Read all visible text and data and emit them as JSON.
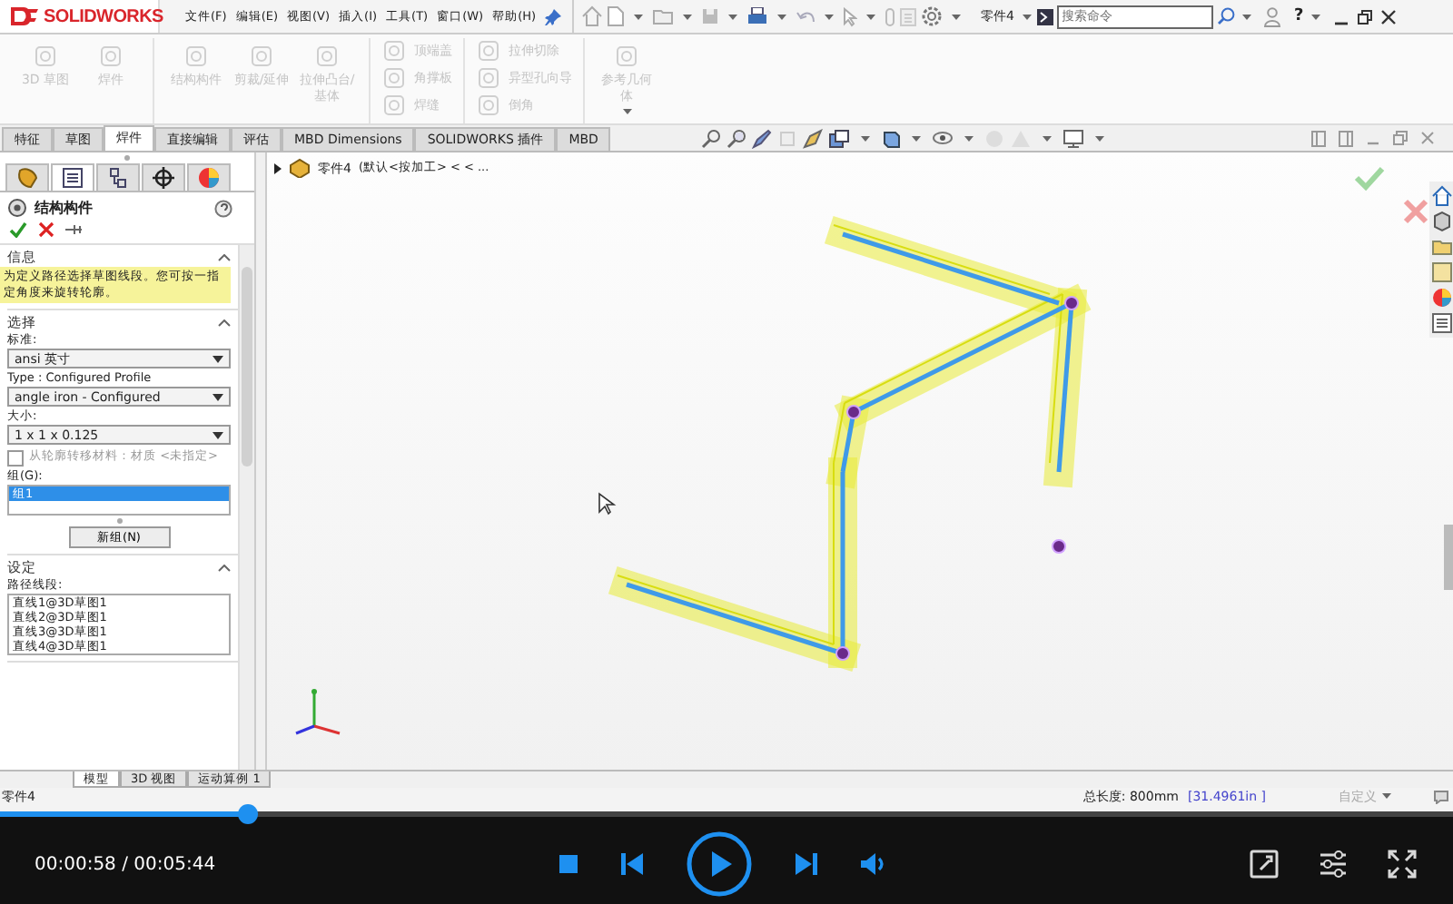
{
  "title_bar": {
    "logo": "SOLIDWORKS",
    "menus": [
      "文件(F)",
      "编辑(E)",
      "视图(V)",
      "插入(I)",
      "工具(T)",
      "窗口(W)",
      "帮助(H)"
    ],
    "document": "零件4",
    "search": {
      "placeholder": "搜索命令"
    },
    "help": "?"
  },
  "ribbon": {
    "groups": [
      {
        "items": [
          {
            "label": "3D 草图",
            "kind": "large",
            "disabled": true
          },
          {
            "label": "焊件",
            "kind": "large",
            "disabled": true
          }
        ]
      },
      {
        "items": [
          {
            "label": "结构构件",
            "kind": "large",
            "disabled": true
          },
          {
            "label": "剪裁/延伸",
            "kind": "large",
            "disabled": true
          },
          {
            "label": "拉伸凸台/基体",
            "kind": "large",
            "disabled": true
          }
        ]
      },
      {
        "items": [
          {
            "label": "顶端盖",
            "kind": "small",
            "disabled": true
          },
          {
            "label": "角撑板",
            "kind": "small",
            "disabled": true
          },
          {
            "label": "焊缝",
            "kind": "small",
            "disabled": true
          }
        ]
      },
      {
        "items": [
          {
            "label": "拉伸切除",
            "kind": "small",
            "disabled": true
          },
          {
            "label": "异型孔向导",
            "kind": "small",
            "disabled": true
          },
          {
            "label": "倒角",
            "kind": "small",
            "disabled": true
          }
        ]
      },
      {
        "items": [
          {
            "label": "参考几何体",
            "kind": "large",
            "disabled": true
          }
        ]
      }
    ]
  },
  "tabs": [
    {
      "label": "特征",
      "selected": false
    },
    {
      "label": "草图",
      "selected": false
    },
    {
      "label": "焊件",
      "selected": true
    },
    {
      "label": "直接编辑",
      "selected": false
    },
    {
      "label": "评估",
      "selected": false
    },
    {
      "label": "MBD Dimensions",
      "selected": false
    },
    {
      "label": "SOLIDWORKS 插件",
      "selected": false
    },
    {
      "label": "MBD",
      "selected": false
    }
  ],
  "feature_tree": {
    "part": "零件4",
    "configuration": "(默认<按加工> < < ..."
  },
  "property_manager": {
    "panel_tabs": [
      {
        "selected": false
      },
      {
        "selected": true
      },
      {
        "selected": false
      },
      {
        "selected": false
      },
      {
        "selected": false
      }
    ],
    "title": "结构构件",
    "sections": [
      {
        "title": "信息",
        "kind": "message",
        "text": "为定义路径选择草图线段。您可按一指定角度来旋转轮廓。"
      },
      {
        "title": "选择",
        "kind": "selection",
        "standard_label": "标准:",
        "standard": "ansi 英寸",
        "type_label": "Type : Configured Profile",
        "type": "angle iron - Configured",
        "size_label": "大小:",
        "size": "1 x 1 x 0.125",
        "transfer_material": {
          "label": "从轮廓转移材料：材质 <未指定>",
          "checked": false
        },
        "groups_label": "组(G):",
        "groups": [
          {
            "label": "组1",
            "selected": true
          }
        ],
        "new_group": "新组(N)"
      },
      {
        "title": "设定",
        "kind": "settings",
        "segments_label": "路径线段:",
        "segments": [
          "直线1@3D草图1",
          "直线2@3D草图1",
          "直线3@3D草图1",
          "直线4@3D草图1"
        ]
      }
    ]
  },
  "bottom_tabs": [
    {
      "label": "模型",
      "selected": true
    },
    {
      "label": "3D 视图",
      "selected": false
    },
    {
      "label": "运动算例 1",
      "selected": false
    }
  ],
  "status_bar": {
    "document": "零件4",
    "total_length": "总长度: 800mm",
    "length_inches": "[31.4961in ]",
    "units": "自定义"
  },
  "player": {
    "level": 0.17,
    "time": "00:00:58 / 00:05:44"
  }
}
